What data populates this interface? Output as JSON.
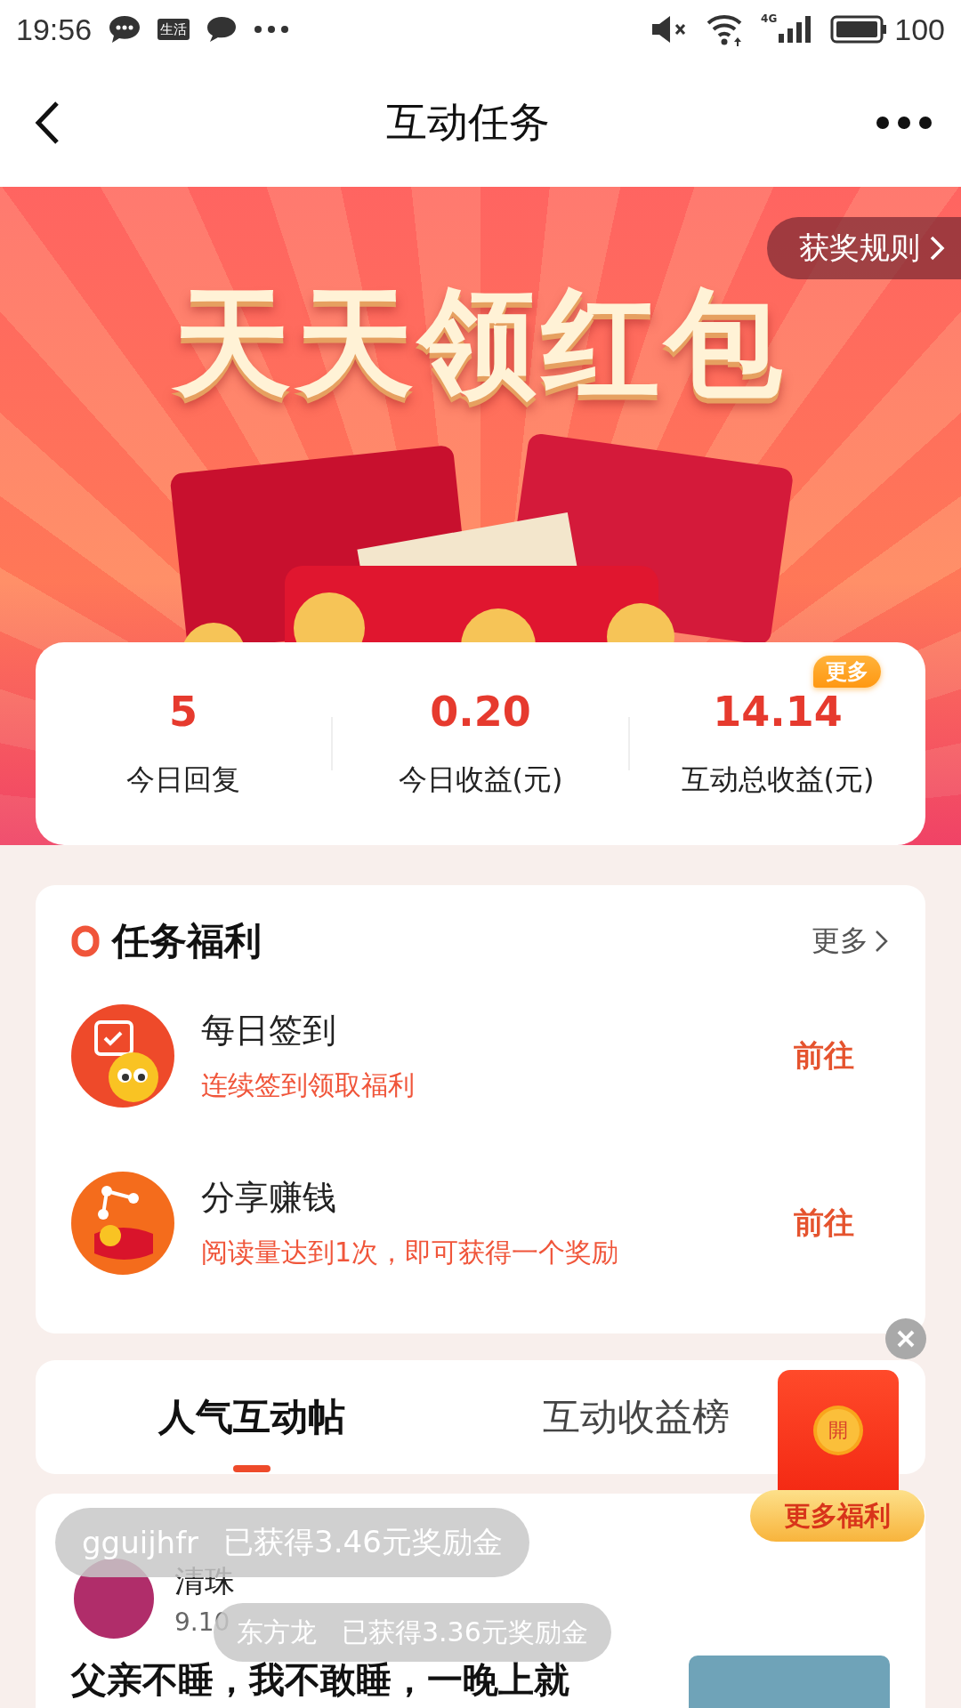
{
  "status_bar": {
    "time": "19:56",
    "app_badge": "生活",
    "network": "4G",
    "battery": "100"
  },
  "nav": {
    "title": "互动任务"
  },
  "banner": {
    "title": "天天领红包",
    "rules_button": "获奖规则"
  },
  "stats": [
    {
      "value": "5",
      "label": "今日回复"
    },
    {
      "value": "0.20",
      "label": "今日收益(元)"
    },
    {
      "value": "14.14",
      "label": "互动总收益(元)",
      "badge": "更多"
    }
  ],
  "tasks_card": {
    "title": "任务福利",
    "more": "更多",
    "tasks": [
      {
        "kind": "calendar",
        "title": "每日签到",
        "subtitle": "连续签到领取福利",
        "action": "前往"
      },
      {
        "kind": "share",
        "title": "分享赚钱",
        "subtitle": "阅读量达到1次，即可获得一个奖励",
        "action": "前往"
      }
    ]
  },
  "tabs": [
    {
      "label": "人气互动帖",
      "selected": true
    },
    {
      "label": "互动收益榜",
      "selected": false
    }
  ],
  "float_promo": {
    "coin": "開",
    "button": "更多福利"
  },
  "post": {
    "author": "清珠",
    "time": "9.10",
    "title": "父亲不睡，我不敢睡，一晚上就"
  },
  "toasts": [
    {
      "user": "gguijhfr",
      "message": "已获得3.46元奖励金"
    },
    {
      "user": "东方龙",
      "message": "已获得3.36元奖励金"
    }
  ]
}
